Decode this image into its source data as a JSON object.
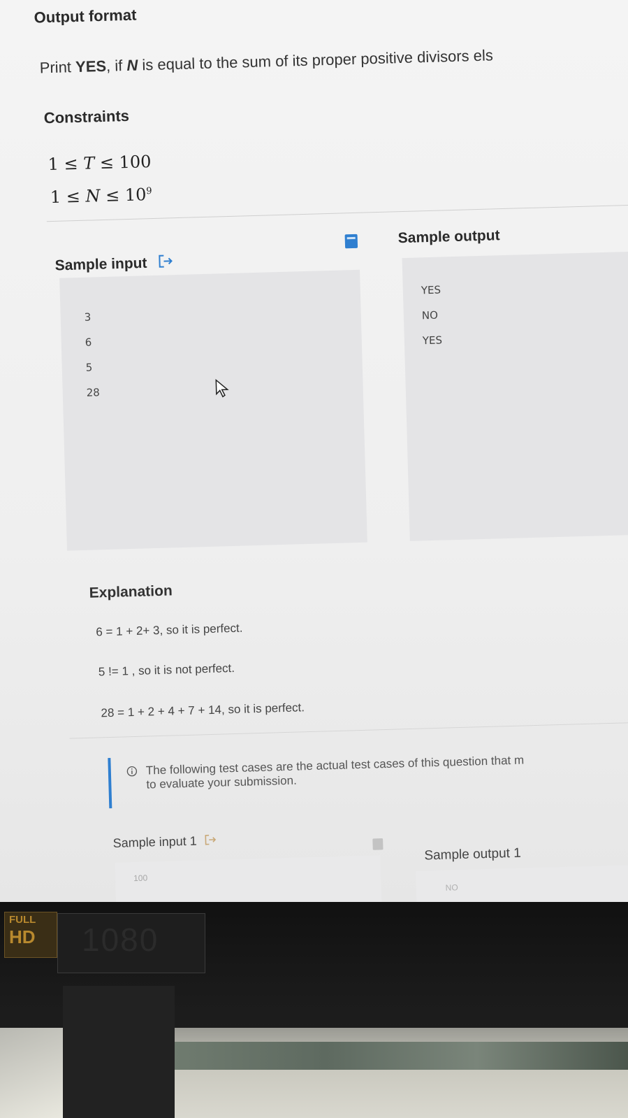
{
  "output_format": {
    "heading": "Output format",
    "text_prefix": "Print ",
    "text_bold": "YES",
    "text_middle": ", if ",
    "text_var": "N",
    "text_suffix": " is equal to the sum of its proper positive divisors els"
  },
  "constraints": {
    "heading": "Constraints",
    "line1_left": "1 ≤ ",
    "line1_var": "T",
    "line1_right": " ≤ 100",
    "line2_left": "1 ≤ ",
    "line2_var": "N",
    "line2_right": " ≤ 10",
    "line2_exp": "9"
  },
  "sample": {
    "input_title": "Sample input",
    "output_title": "Sample output",
    "input_lines": [
      "3",
      "6",
      "5",
      "28"
    ],
    "output_lines": [
      "YES",
      "NO",
      "YES"
    ]
  },
  "explanation": {
    "heading": "Explanation",
    "lines": [
      "6 = 1 + 2+ 3, so it is perfect.",
      "5 != 1 , so it is not perfect.",
      "28 = 1 + 2 + 4 + 7 + 14, so it is perfect."
    ]
  },
  "notice": {
    "line1": "The following test cases are the actual test cases of this question that m",
    "line2": "to evaluate your submission."
  },
  "sample1": {
    "input_title": "Sample input 1",
    "output_title": "Sample output 1",
    "input_value": "100",
    "output_value": "NO"
  },
  "monitor": {
    "badge_top": "FULL",
    "badge_bottom": "HD",
    "resolution": "1080"
  },
  "colors": {
    "accent": "#2f7fd0",
    "page_bg": "#f2f2f2",
    "box_bg": "#e4e4e6",
    "bezel": "#1a1a1a",
    "badge": "#b8892e"
  },
  "icons": [
    "export-icon",
    "copy-icon",
    "cursor-icon",
    "info-icon"
  ]
}
